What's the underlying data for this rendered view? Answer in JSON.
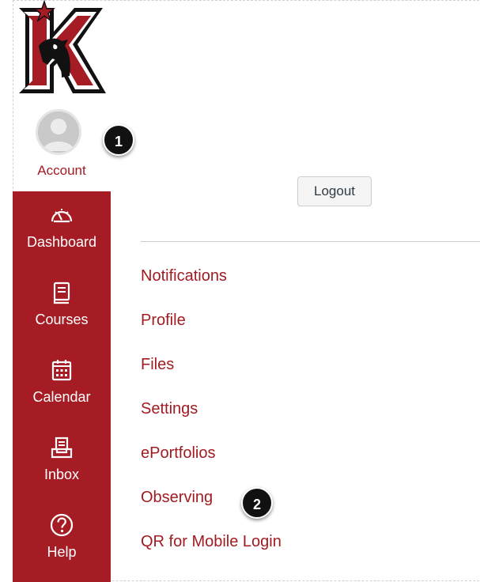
{
  "account": {
    "label": "Account"
  },
  "logout_label": "Logout",
  "sidebar": {
    "items": [
      {
        "label": "Dashboard",
        "icon": "dashboard-icon"
      },
      {
        "label": "Courses",
        "icon": "courses-icon"
      },
      {
        "label": "Calendar",
        "icon": "calendar-icon"
      },
      {
        "label": "Inbox",
        "icon": "inbox-icon"
      },
      {
        "label": "Help",
        "icon": "help-icon"
      }
    ]
  },
  "menu": {
    "items": [
      {
        "label": "Notifications"
      },
      {
        "label": "Profile"
      },
      {
        "label": "Files"
      },
      {
        "label": "Settings"
      },
      {
        "label": "ePortfolios"
      },
      {
        "label": "Observing"
      },
      {
        "label": "QR for Mobile Login"
      }
    ]
  },
  "callouts": [
    "1",
    "2"
  ],
  "colors": {
    "brand": "#a51c24",
    "link": "#a01c22",
    "badge": "#111111"
  }
}
